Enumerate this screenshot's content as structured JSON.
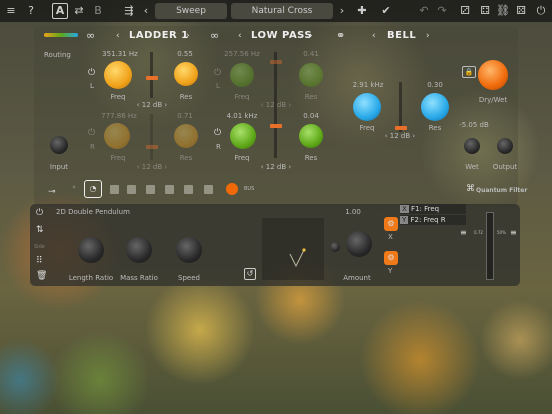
{
  "topbar": {
    "menu_icon": "≡",
    "help_icon": "?",
    "a_label": "A",
    "b_label": "B",
    "preset_left": "Sweep",
    "preset_right": "Natural Cross",
    "prev": "‹",
    "next": "›"
  },
  "filters": {
    "f1_name": "LADDER 1",
    "f2_name": "LOW PASS",
    "f3_name": "BELL",
    "routing": "Routing",
    "f1": {
      "freq_top": "351.31 Hz",
      "res_top": "0.55",
      "freq_bot": "777.86 Hz",
      "res_bot": "0.71",
      "db": "12 dB",
      "freq": "Freq",
      "res": "Res",
      "L": "L",
      "R": "R"
    },
    "f2": {
      "freq_top": "257.56 Hz",
      "res_top": "0.41",
      "freq_bot": "4.01 kHz",
      "res_bot": "0.04",
      "db": "12 dB",
      "db2": "12 dB",
      "freq": "Freq",
      "res": "Res",
      "L": "L",
      "R": "R"
    },
    "f3": {
      "freq_val": "2.91 kHz",
      "res_val": "0.30",
      "freq": "Freq",
      "res": "Res",
      "db": "12 dB"
    },
    "input": "Input",
    "drywet": "Dry/Wet",
    "gain": "-5.05 dB",
    "wet": "Wet",
    "output": "Output",
    "logo": "Quantum Filter",
    "bus": "BUS"
  },
  "mod": {
    "title": "2D Double Pendulum",
    "length": "Length Ratio",
    "mass": "Mass Ratio",
    "speed": "Speed",
    "amount": "Amount",
    "amount_val": "1.00",
    "x": "X",
    "y": "Y",
    "f1": "F1: Freq",
    "f2": "F2: Freq R",
    "side": "Side",
    "m1": "0.72",
    "m2": "50%"
  },
  "colors": {
    "orange": "#f0a21a",
    "green": "#5fa818",
    "blue": "#27a8e8",
    "accent": "#e8702a"
  }
}
